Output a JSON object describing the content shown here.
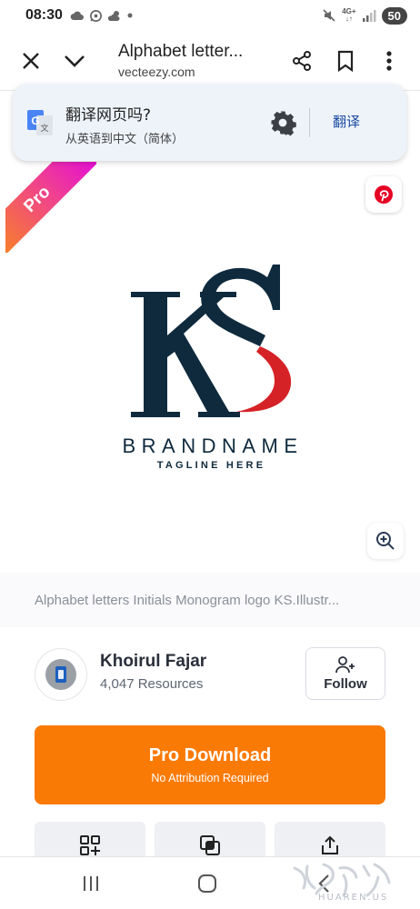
{
  "status_bar": {
    "time": "08:30",
    "network": "4G+",
    "battery": "50",
    "icons": [
      "cloud-icon",
      "whatsapp-icon",
      "weather-icon",
      "dot-icon",
      "mute-icon",
      "signal-icon"
    ]
  },
  "browser": {
    "title": "Alphabet letter...",
    "domain": "vecteezy.com",
    "icons": [
      "close-icon",
      "chevron-down-icon",
      "share-icon",
      "bookmark-icon",
      "more-vert-icon"
    ]
  },
  "translate_prompt": {
    "question": "翻译网页吗?",
    "languages": "从英语到中文（简体）",
    "action": "翻译",
    "logo_letter_main": "G",
    "logo_letter_small": "文"
  },
  "asset": {
    "badge": "Pro",
    "brand_name": "BRANDNAME",
    "tagline": "TAGLINE HERE",
    "caption": "Alphabet letters Initials Monogram logo KS.Illustr...",
    "colors": {
      "navy": "#0f2a3d",
      "red": "#d52227"
    }
  },
  "author": {
    "name": "Khoirul Fajar",
    "resources": "4,047 Resources",
    "follow_label": "Follow"
  },
  "download": {
    "title": "Pro Download",
    "subtitle": "No Attribution Required",
    "color": "#fa7a06"
  },
  "actions": [
    "add-to-collection-icon",
    "similar-icon",
    "share-icon"
  ],
  "watermark": {
    "text": "HUAREN.US"
  },
  "nav": [
    "recent-apps-icon",
    "home-icon",
    "back-icon"
  ]
}
